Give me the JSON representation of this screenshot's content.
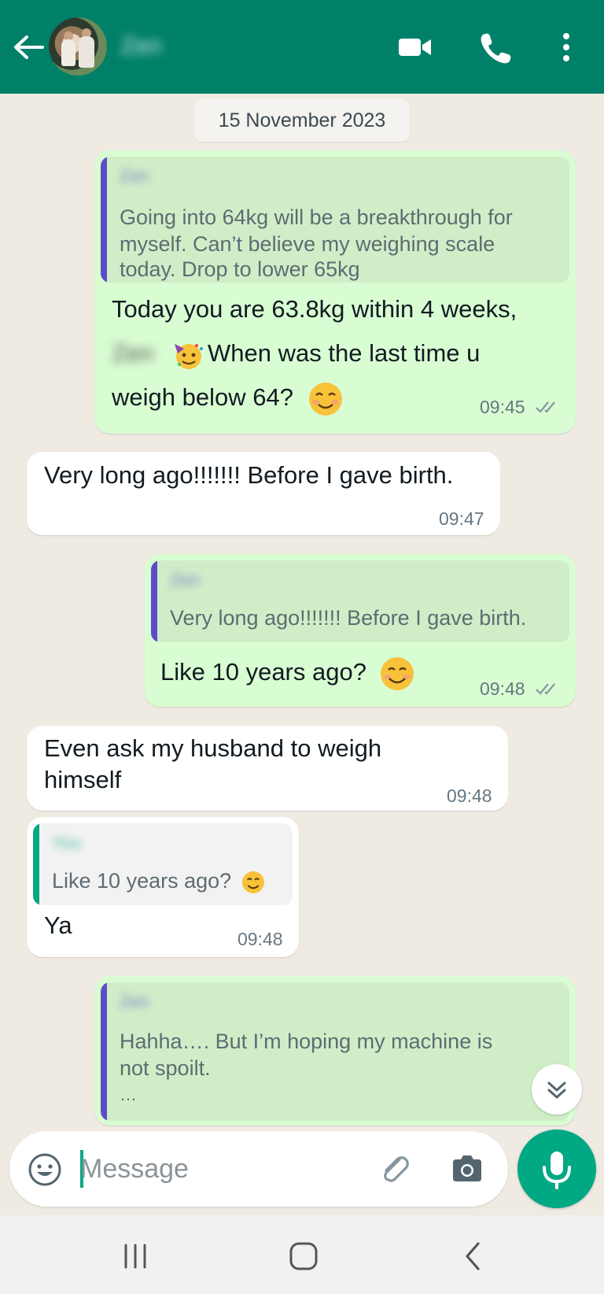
{
  "header": {
    "contact_name": "Zen",
    "icons": [
      "back-arrow-icon",
      "video-call-icon",
      "phone-icon",
      "more-vert-icon"
    ]
  },
  "date_separator": "15 November 2023",
  "messages": [
    {
      "direction": "out",
      "quote_author": "Zen",
      "quote_text_lines": [
        "Going into 64kg will be a breakthrough for",
        "myself. Can’t believe my weighing scale",
        "today. Drop to lower 65kg"
      ],
      "text_line1": "Today you are 63.8kg within 4 weeks,",
      "text_name": "Zen",
      "text_line2_rest": "When was the last time u",
      "text_line3": "weigh below 64?",
      "time": "09:45",
      "status": "read"
    },
    {
      "direction": "in",
      "text": "Very long ago!!!!!!! Before I gave birth.",
      "time": "09:47"
    },
    {
      "direction": "out",
      "quote_author": "Zen",
      "quote_text": "Very long ago!!!!!!! Before I gave birth.",
      "text": "Like 10 years ago?",
      "time": "09:48",
      "status": "read"
    },
    {
      "direction": "in",
      "text_lines": [
        "Even ask my husband to weigh",
        "himself"
      ],
      "time": "09:48"
    },
    {
      "direction": "in",
      "quote_author": "You",
      "quote_text": "Like 10 years ago?",
      "text": "Ya",
      "time": "09:48"
    },
    {
      "direction": "out",
      "quote_author": "Zen",
      "quote_text_lines": [
        "Hahha…. But I’m hoping my machine is",
        "not spoilt.",
        "…"
      ]
    }
  ],
  "composer": {
    "placeholder": "Message",
    "icons": [
      "emoji-icon",
      "attach-icon",
      "camera-icon",
      "mic-icon"
    ]
  },
  "colors": {
    "header": "#008069",
    "chat_bg": "#efeae2",
    "outgoing_bubble": "#d9fdd3",
    "incoming_bubble": "#ffffff",
    "accent": "#00a884",
    "read_ticks": "#8696a0"
  }
}
